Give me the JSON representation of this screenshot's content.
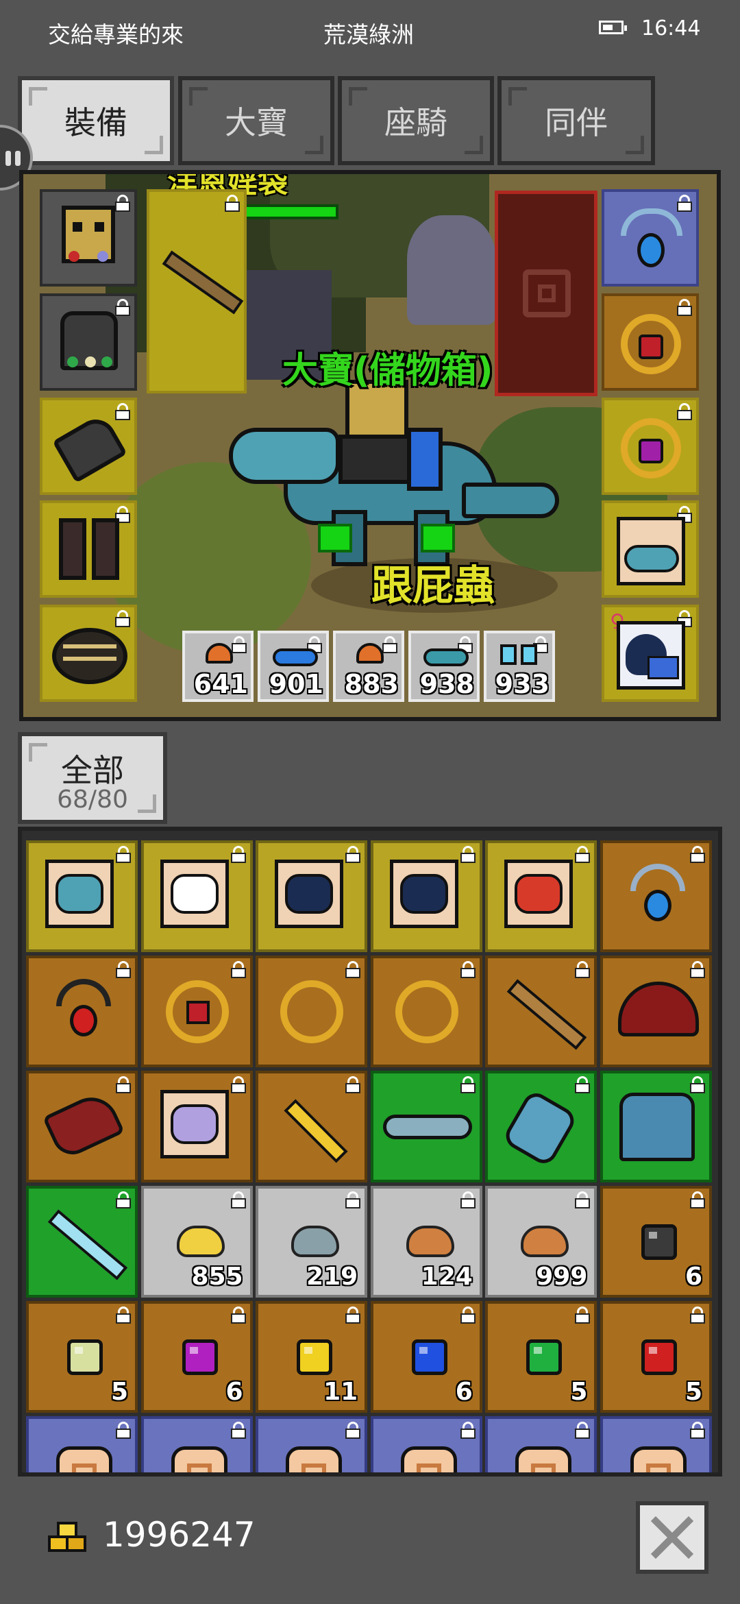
{
  "status_bar": {
    "left_text": "交給專業的來",
    "center_text": "荒漠綠洲",
    "time": "16:44",
    "battery_icon": "battery-icon"
  },
  "tabs": [
    {
      "label": "裝備",
      "active": true
    },
    {
      "label": "大寶",
      "active": false
    },
    {
      "label": "座騎",
      "active": false
    },
    {
      "label": "同伴",
      "active": false
    }
  ],
  "scene": {
    "top_name_partial": "洋恩婬袋",
    "pet_label": "大寶(儲物箱)",
    "companion_label": "跟屁蟲",
    "colors": {
      "pet_label": "#34d61d",
      "companion_label": "#e2e22a"
    }
  },
  "potions": [
    {
      "count": "641",
      "icon": "mushroom-potion-icon"
    },
    {
      "count": "901",
      "icon": "blue-fish-icon"
    },
    {
      "count": "883",
      "icon": "mushroom-potion-icon"
    },
    {
      "count": "938",
      "icon": "teal-fish-icon"
    },
    {
      "count": "933",
      "icon": "twin-potion-icon"
    }
  ],
  "equipment_left": [
    {
      "icon": "gold-helmet-icon",
      "color": "gray"
    },
    {
      "icon": "dark-armor-icon",
      "color": "gray"
    },
    {
      "icon": "gauntlet-icon",
      "color": "yellow"
    },
    {
      "icon": "boots-icon",
      "color": "yellow"
    },
    {
      "icon": "belt-icon",
      "color": "yellow"
    }
  ],
  "equipment_weapon": {
    "icon": "bow-icon"
  },
  "equipment_right": [
    {
      "icon": "blue-amulet-icon",
      "color": "blue"
    },
    {
      "icon": "ruby-ring-icon",
      "color": "orange"
    },
    {
      "icon": "amethyst-ring-icon",
      "color": "yellow"
    },
    {
      "icon": "dragon-card-icon",
      "color": "yellow"
    },
    {
      "icon": "magpie-card-icon",
      "color": "yellow"
    }
  ],
  "inventory": {
    "filter_label": "全部",
    "capacity": "68/80",
    "rows": [
      [
        {
          "icon": "dragon-card-icon",
          "bg": "y",
          "qty": ""
        },
        {
          "icon": "snowman-card-icon",
          "bg": "y",
          "qty": ""
        },
        {
          "icon": "magpie-card-icon",
          "bg": "y",
          "qty": ""
        },
        {
          "icon": "magpie-card-icon",
          "bg": "y",
          "qty": ""
        },
        {
          "icon": "rooster-card-icon",
          "bg": "y",
          "qty": ""
        },
        {
          "icon": "blue-amulet-icon",
          "bg": "o",
          "qty": ""
        }
      ],
      [
        {
          "icon": "ruby-amulet-icon",
          "bg": "o",
          "qty": ""
        },
        {
          "icon": "ruby-ring-icon",
          "bg": "o",
          "qty": ""
        },
        {
          "icon": "gold-earring-icon",
          "bg": "o",
          "qty": ""
        },
        {
          "icon": "gold-earring-icon",
          "bg": "o",
          "qty": ""
        },
        {
          "icon": "red-bow-icon",
          "bg": "o",
          "qty": ""
        },
        {
          "icon": "red-hat-icon",
          "bg": "o",
          "qty": ""
        }
      ],
      [
        {
          "icon": "red-glove-icon",
          "bg": "o",
          "qty": ""
        },
        {
          "icon": "unicorn-card-icon",
          "bg": "o",
          "qty": ""
        },
        {
          "icon": "gold-sword-icon",
          "bg": "o",
          "qty": ""
        },
        {
          "icon": "steel-belt-icon",
          "bg": "g",
          "qty": ""
        },
        {
          "icon": "steel-gauntlet-icon",
          "bg": "g",
          "qty": ""
        },
        {
          "icon": "steel-armor-icon",
          "bg": "g",
          "qty": ""
        }
      ],
      [
        {
          "icon": "crystal-bow-icon",
          "bg": "g",
          "qty": ""
        },
        {
          "icon": "gold-ore-icon",
          "bg": "gr",
          "qty": "855"
        },
        {
          "icon": "iron-ore-icon",
          "bg": "gr",
          "qty": "219"
        },
        {
          "icon": "copper-ore-icon",
          "bg": "gr",
          "qty": "124"
        },
        {
          "icon": "copper-ore-icon",
          "bg": "gr",
          "qty": "999"
        },
        {
          "icon": "black-gem-icon",
          "bg": "o",
          "qty": "6"
        }
      ],
      [
        {
          "icon": "pale-gem-icon",
          "bg": "o",
          "qty": "5"
        },
        {
          "icon": "purple-gem-icon",
          "bg": "o",
          "qty": "6"
        },
        {
          "icon": "yellow-gem-icon",
          "bg": "o",
          "qty": "11"
        },
        {
          "icon": "blue-gem-icon",
          "bg": "o",
          "qty": "6"
        },
        {
          "icon": "green-gem-icon",
          "bg": "o",
          "qty": "5"
        },
        {
          "icon": "red-gem-icon",
          "bg": "o",
          "qty": "5"
        }
      ],
      [
        {
          "icon": "scroll-icon",
          "bg": "b",
          "qty": ""
        },
        {
          "icon": "scroll-icon",
          "bg": "b",
          "qty": ""
        },
        {
          "icon": "scroll-icon",
          "bg": "b",
          "qty": ""
        },
        {
          "icon": "scroll-icon",
          "bg": "b",
          "qty": ""
        },
        {
          "icon": "scroll-icon",
          "bg": "b",
          "qty": ""
        },
        {
          "icon": "scroll-icon",
          "bg": "b",
          "qty": ""
        }
      ]
    ]
  },
  "footer": {
    "gold_amount": "1996247",
    "gold_icon": "gold-coins-icon",
    "close_icon": "close-icon"
  }
}
